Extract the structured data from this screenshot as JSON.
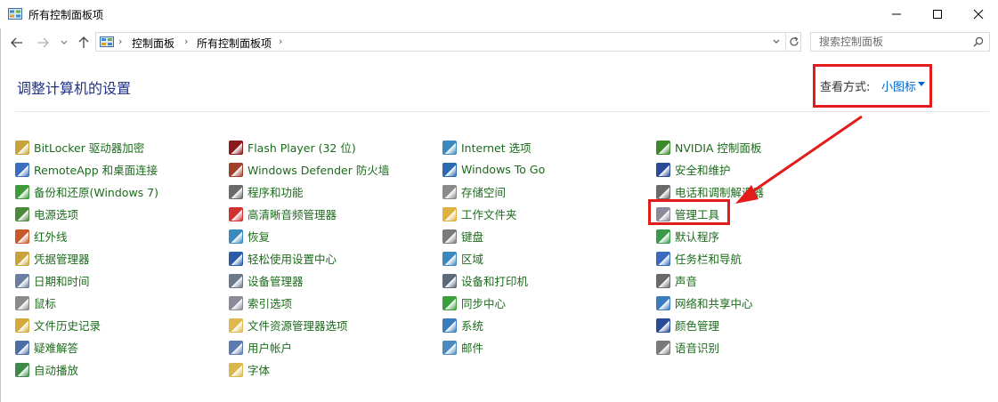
{
  "window": {
    "title": "所有控制面板项"
  },
  "address": {
    "crumbs": [
      "控制面板",
      "所有控制面板项"
    ],
    "separator": "›"
  },
  "search": {
    "placeholder": "搜索控制面板"
  },
  "main": {
    "heading": "调整计算机的设置",
    "view_by_label": "查看方式:",
    "view_by_value": "小图标"
  },
  "columns": [
    [
      {
        "label": "BitLocker 驱动器加密",
        "icon": "bitlocker-icon",
        "color": "#c8a23a"
      },
      {
        "label": "RemoteApp 和桌面连接",
        "icon": "remoteapp-icon",
        "color": "#3a6fbf"
      },
      {
        "label": "备份和还原(Windows 7)",
        "icon": "backup-icon",
        "color": "#3f9a3a"
      },
      {
        "label": "电源选项",
        "icon": "power-options-icon",
        "color": "#4a8a3a"
      },
      {
        "label": "红外线",
        "icon": "infrared-icon",
        "color": "#c85a2a"
      },
      {
        "label": "凭据管理器",
        "icon": "credential-icon",
        "color": "#c8a23a"
      },
      {
        "label": "日期和时间",
        "icon": "clock-icon",
        "color": "#6a7fa0"
      },
      {
        "label": "鼠标",
        "icon": "mouse-icon",
        "color": "#8a8a8a"
      },
      {
        "label": "文件历史记录",
        "icon": "file-history-icon",
        "color": "#d2a93a"
      },
      {
        "label": "疑难解答",
        "icon": "troubleshoot-icon",
        "color": "#4a6fa8"
      },
      {
        "label": "自动播放",
        "icon": "autoplay-icon",
        "color": "#3f8a4a"
      }
    ],
    [
      {
        "label": "Flash Player (32 位)",
        "icon": "flash-icon",
        "color": "#8a1a1a"
      },
      {
        "label": "Windows Defender 防火墙",
        "icon": "firewall-icon",
        "color": "#a0402a"
      },
      {
        "label": "程序和功能",
        "icon": "programs-icon",
        "color": "#6a6a6a"
      },
      {
        "label": "高清晰音频管理器",
        "icon": "audio-manager-icon",
        "color": "#d03030"
      },
      {
        "label": "恢复",
        "icon": "recovery-icon",
        "color": "#3a8abf"
      },
      {
        "label": "轻松使用设置中心",
        "icon": "ease-of-access-icon",
        "color": "#2a5aa8"
      },
      {
        "label": "设备管理器",
        "icon": "device-manager-icon",
        "color": "#6a7a8a"
      },
      {
        "label": "索引选项",
        "icon": "indexing-icon",
        "color": "#8a8a9a"
      },
      {
        "label": "文件资源管理器选项",
        "icon": "folder-options-icon",
        "color": "#e0b850"
      },
      {
        "label": "用户帐户",
        "icon": "user-accounts-icon",
        "color": "#5a7ab0"
      },
      {
        "label": "字体",
        "icon": "fonts-icon",
        "color": "#d8b84a"
      }
    ],
    [
      {
        "label": "Internet 选项",
        "icon": "internet-options-icon",
        "color": "#3a8abf"
      },
      {
        "label": "Windows To Go",
        "icon": "windows-to-go-icon",
        "color": "#2a6ab0"
      },
      {
        "label": "存储空间",
        "icon": "storage-spaces-icon",
        "color": "#8a8a8a"
      },
      {
        "label": "工作文件夹",
        "icon": "work-folders-icon",
        "color": "#e0b040"
      },
      {
        "label": "键盘",
        "icon": "keyboard-icon",
        "color": "#7a7a7a"
      },
      {
        "label": "区域",
        "icon": "region-icon",
        "color": "#3a8abf"
      },
      {
        "label": "设备和打印机",
        "icon": "printer-icon",
        "color": "#5a6a7a"
      },
      {
        "label": "同步中心",
        "icon": "sync-center-icon",
        "color": "#3aa03a"
      },
      {
        "label": "系统",
        "icon": "system-icon",
        "color": "#3a7abf"
      },
      {
        "label": "邮件",
        "icon": "mail-icon",
        "color": "#4a8ac0"
      }
    ],
    [
      {
        "label": "NVIDIA 控制面板",
        "icon": "nvidia-icon",
        "color": "#3a8a2a"
      },
      {
        "label": "安全和维护",
        "icon": "security-maintenance-icon",
        "color": "#2a4a9a"
      },
      {
        "label": "电话和调制解调器",
        "icon": "phone-modem-icon",
        "color": "#6a6a6a"
      },
      {
        "label": "管理工具",
        "icon": "admin-tools-icon",
        "color": "#8a8a9a"
      },
      {
        "label": "默认程序",
        "icon": "default-programs-icon",
        "color": "#3a9a4a"
      },
      {
        "label": "任务栏和导航",
        "icon": "taskbar-icon",
        "color": "#3a6abf"
      },
      {
        "label": "声音",
        "icon": "sound-icon",
        "color": "#6a6a6a"
      },
      {
        "label": "网络和共享中心",
        "icon": "network-icon",
        "color": "#3a7abf"
      },
      {
        "label": "颜色管理",
        "icon": "color-management-icon",
        "color": "#2a4a9a"
      },
      {
        "label": "语音识别",
        "icon": "speech-icon",
        "color": "#7a7a7a"
      }
    ]
  ],
  "annotation": {
    "highlight_color": "#e21b1b"
  }
}
